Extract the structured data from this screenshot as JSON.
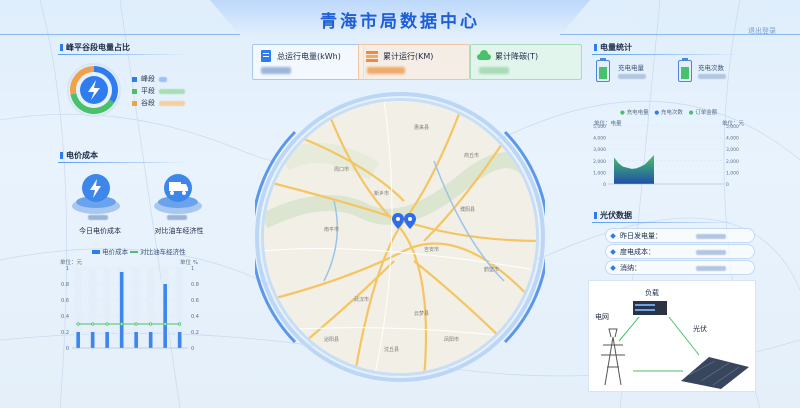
{
  "header": {
    "title": "青海市局数据中心",
    "logout": "退出登录"
  },
  "peak_panel": {
    "title": "峰平谷段电量占比",
    "legend": [
      {
        "label": "峰段",
        "color": "#2f7cf0"
      },
      {
        "label": "平段",
        "color": "#49c16a"
      },
      {
        "label": "谷段",
        "color": "#f0a24a"
      }
    ],
    "donut": [
      {
        "name": "峰段",
        "fraction": 0.34,
        "color": "#2f7cf0"
      },
      {
        "name": "平段",
        "fraction": 0.38,
        "color": "#49c16a"
      },
      {
        "name": "谷段",
        "fraction": 0.28,
        "color": "#f0a24a"
      }
    ]
  },
  "cost_panel": {
    "title": "电价成本",
    "items": [
      {
        "label": "今日电价成本"
      },
      {
        "label": "对比油车经济性"
      }
    ]
  },
  "cost_chart": {
    "legend": [
      "电价成本",
      "对比油车经济性"
    ],
    "y_left_label": "单位：元",
    "y_right_label": "单位 %"
  },
  "chart_data": [
    {
      "type": "bar",
      "title": "",
      "ylabel": "单位：元",
      "ylim": [
        0,
        1
      ],
      "y_ticks": [
        "1",
        "0.8",
        "0.6",
        "0.4",
        "0.2",
        "0"
      ],
      "y_right_ticks": [
        "1",
        "0.8",
        "0.6",
        "0.4",
        "0.2",
        "0"
      ],
      "series": [
        {
          "name": "电价成本",
          "values": [
            0.2,
            0.2,
            0.2,
            0.95,
            0.2,
            0.2,
            0.8,
            0.2
          ]
        },
        {
          "name": "对比油车经济性",
          "values": [
            0.3,
            0.3,
            0.3,
            0.3,
            0.3,
            0.3,
            0.3,
            0.3
          ]
        }
      ]
    },
    {
      "type": "area",
      "title": "",
      "ylabel": "单位：电量",
      "ylim": [
        0,
        5000
      ],
      "y_ticks": [
        "5,000",
        "4,000",
        "3,000",
        "2,000",
        "1,000",
        "0"
      ],
      "y_right_ticks": [
        "5,000",
        "4,000",
        "3,000",
        "2,000",
        "1,000",
        "0"
      ],
      "y_right_label": "单位：元",
      "series": [
        {
          "name": "充电电量",
          "values": [
            2300,
            1800,
            1500,
            1400,
            1300,
            1350,
            1500,
            1700,
            2100,
            2500
          ]
        },
        {
          "name": "充电次数",
          "values": [
            0,
            0,
            0,
            0,
            0,
            0,
            0,
            0,
            0,
            0
          ]
        },
        {
          "name": "订单金额",
          "values": [
            0,
            0,
            0,
            0,
            0,
            0,
            0,
            0,
            0,
            0
          ]
        }
      ]
    }
  ],
  "stats": [
    {
      "label": "总运行电量(kWh)",
      "color": "#2f7cf0"
    },
    {
      "label": "累计运行(KM)",
      "color": "#f08a3c"
    },
    {
      "label": "累计降碳(T)",
      "color": "#49c16a"
    }
  ],
  "power_stats": {
    "title": "电量统计",
    "items": [
      {
        "label": "充电电量"
      },
      {
        "label": "充电次数"
      }
    ],
    "legend": [
      "充电电量",
      "充电次数",
      "订单金额"
    ]
  },
  "pv_panel": {
    "title": "光伏数据",
    "rows": [
      {
        "label": "昨日发电量："
      },
      {
        "label": "度电成本："
      },
      {
        "label": "消纳："
      }
    ],
    "diagram": {
      "load": "负载",
      "grid": "电网",
      "pv": "光伏"
    }
  },
  "map": {
    "cities": [
      "惠来县",
      "周口市",
      "商丘市",
      "新乡市",
      "吉安市",
      "南平市",
      "濮阳县",
      "鹤壁市",
      "武汉市",
      "云梦县",
      "凤阳市",
      "泌阳县",
      "沈丘县"
    ]
  }
}
